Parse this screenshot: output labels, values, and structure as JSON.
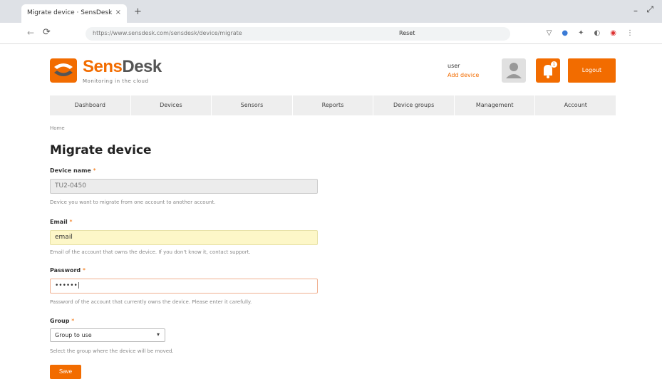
{
  "browser": {
    "tab_title": "Migrate device · SensDesk",
    "new_tab": "+",
    "close_tab": "×",
    "url": "https://www.sensdesk.com/sensdesk/device/migrate",
    "url_extra": "Reset",
    "win_min": "–",
    "win_max": "⤢"
  },
  "header": {
    "logo_sens": "Sens",
    "logo_desk": "Desk",
    "logo_tagline": "Monitoring in the cloud",
    "user_name": "user",
    "user_link": "Add device",
    "alert_count": "1",
    "logout_label": "Logout"
  },
  "nav": {
    "items": [
      "Dashboard",
      "Devices",
      "Sensors",
      "Reports",
      "Device groups",
      "Management",
      "Account"
    ]
  },
  "breadcrumb": "Home",
  "page": {
    "title": "Migrate device"
  },
  "form": {
    "device": {
      "label": "Device name",
      "value": "TU2-0450",
      "help": "Device you want to migrate from one account to another account."
    },
    "email": {
      "label": "Email",
      "value": "email",
      "help": "Email of the account that owns the device. If you don't know it, contact support."
    },
    "password": {
      "label": "Password",
      "value": "••••••|",
      "help": "Password of the account that currently owns the device. Please enter it carefully."
    },
    "group": {
      "label": "Group",
      "value": "Group to use",
      "help": "Select the group where the device will be moved."
    },
    "save_label": "Save"
  },
  "colors": {
    "accent": "#f26c00"
  }
}
